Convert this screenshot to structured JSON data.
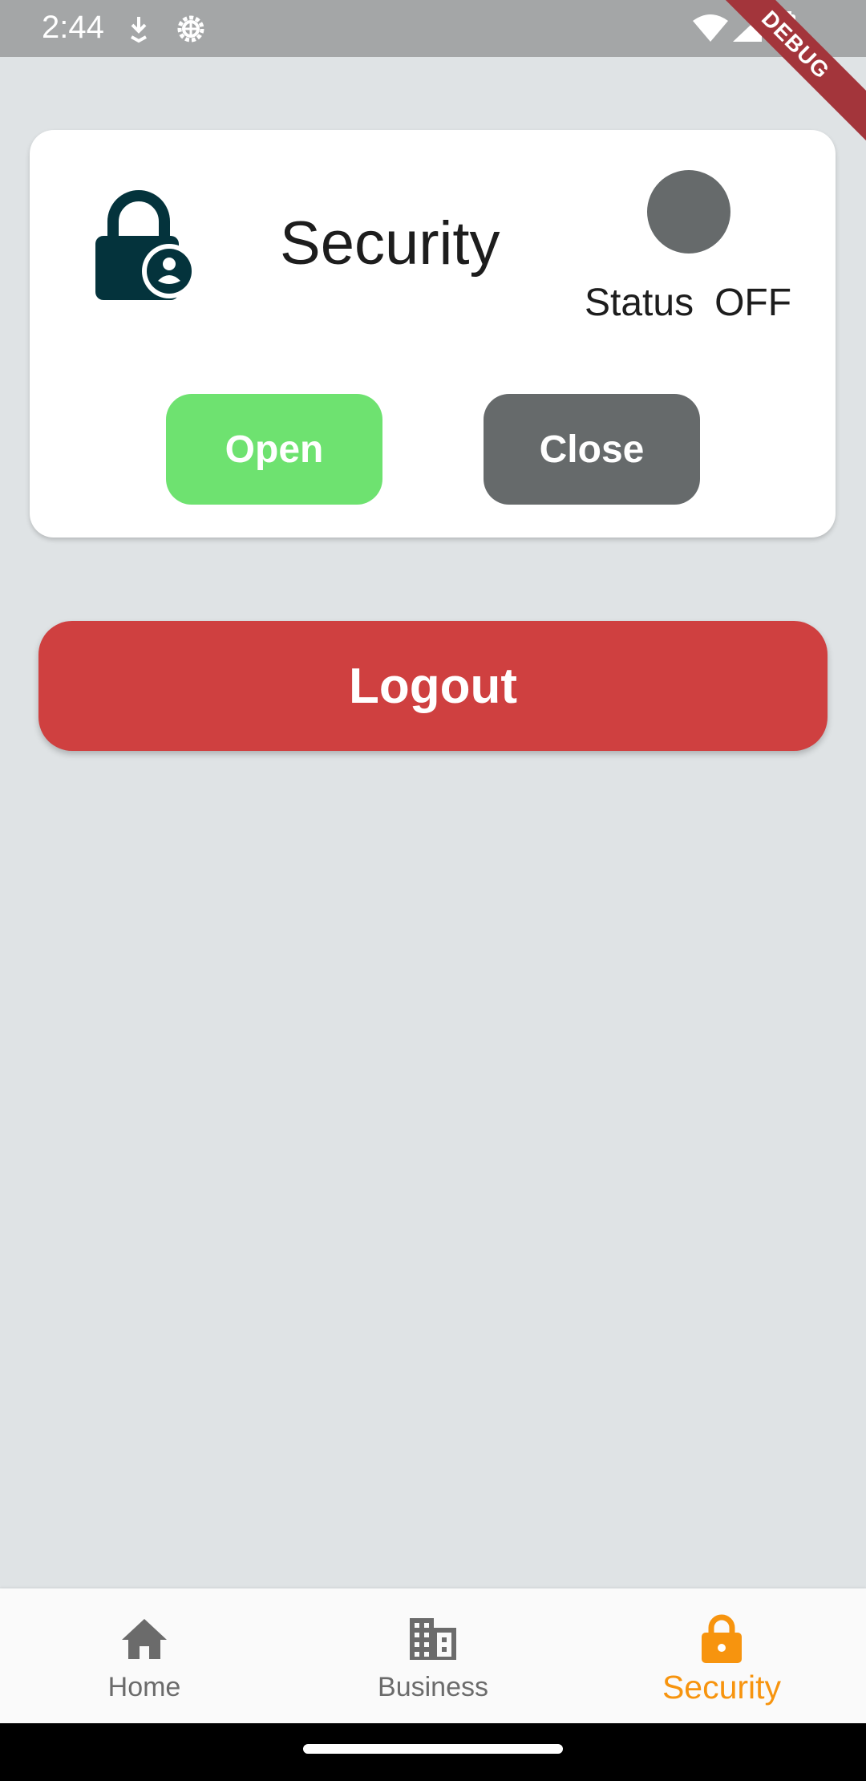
{
  "status_bar": {
    "time": "2:44",
    "icons": [
      "download-icon",
      "settings-gear-icon",
      "wifi-icon",
      "signal-icon",
      "battery-icon"
    ],
    "debug_banner": "DEBUG"
  },
  "card": {
    "title": "Security",
    "icon": "lock-person-icon",
    "status_label": "Status",
    "status_value": "OFF",
    "status_color": "#666a6b",
    "open_label": "Open",
    "close_label": "Close",
    "open_color": "#6ee270",
    "close_color": "#666a6b"
  },
  "logout": {
    "label": "Logout",
    "color": "#cf4040"
  },
  "bottom_nav": {
    "items": [
      {
        "label": "Home",
        "icon": "home-icon",
        "active": false
      },
      {
        "label": "Business",
        "icon": "business-icon",
        "active": false
      },
      {
        "label": "Security",
        "icon": "lock-icon",
        "active": true
      }
    ],
    "active_color": "#f7940e",
    "inactive_color": "#6b6b6b"
  }
}
